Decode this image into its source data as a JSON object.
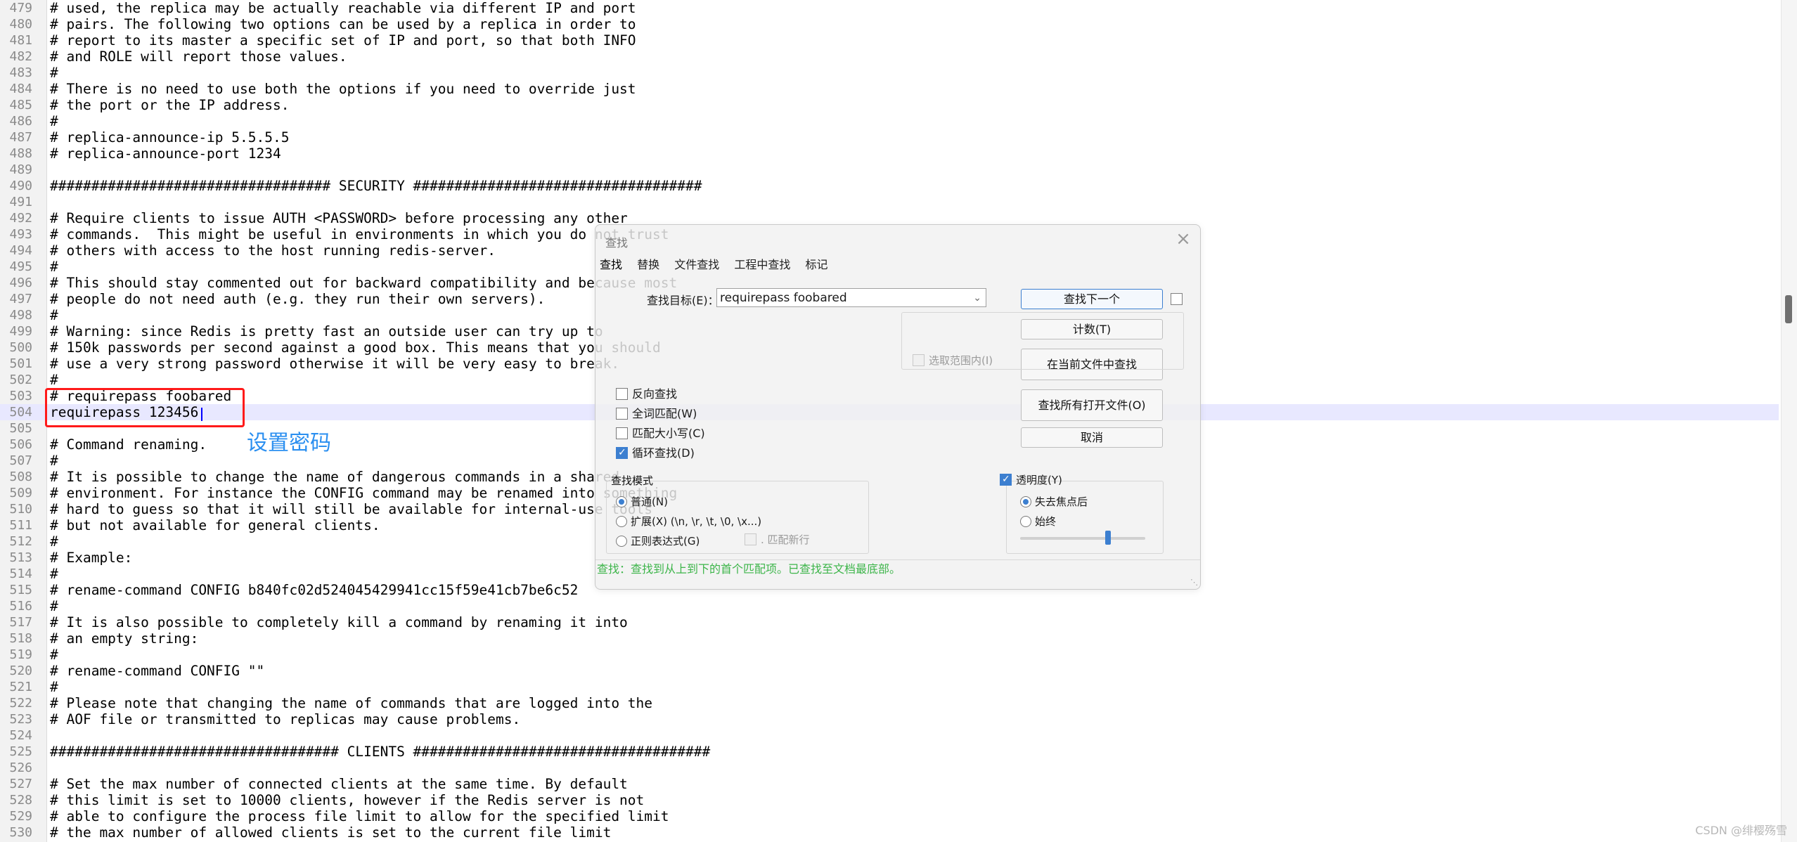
{
  "editor": {
    "lines": [
      {
        "num": "479",
        "text": "# used, the replica may be actually reachable via different IP and port"
      },
      {
        "num": "480",
        "text": "# pairs. The following two options can be used by a replica in order to"
      },
      {
        "num": "481",
        "text": "# report to its master a specific set of IP and port, so that both INFO"
      },
      {
        "num": "482",
        "text": "# and ROLE will report those values."
      },
      {
        "num": "483",
        "text": "#"
      },
      {
        "num": "484",
        "text": "# There is no need to use both the options if you need to override just"
      },
      {
        "num": "485",
        "text": "# the port or the IP address."
      },
      {
        "num": "486",
        "text": "#"
      },
      {
        "num": "487",
        "text": "# replica-announce-ip 5.5.5.5"
      },
      {
        "num": "488",
        "text": "# replica-announce-port 1234"
      },
      {
        "num": "489",
        "text": ""
      },
      {
        "num": "490",
        "text": "################################## SECURITY ###################################"
      },
      {
        "num": "491",
        "text": ""
      },
      {
        "num": "492",
        "text": "# Require clients to issue AUTH <PASSWORD> before processing any other"
      },
      {
        "num": "493",
        "text": "# commands.  This might be useful in environments in which you do not trust"
      },
      {
        "num": "494",
        "text": "# others with access to the host running redis-server."
      },
      {
        "num": "495",
        "text": "#"
      },
      {
        "num": "496",
        "text": "# This should stay commented out for backward compatibility and because most"
      },
      {
        "num": "497",
        "text": "# people do not need auth (e.g. they run their own servers)."
      },
      {
        "num": "498",
        "text": "#"
      },
      {
        "num": "499",
        "text": "# Warning: since Redis is pretty fast an outside user can try up to"
      },
      {
        "num": "500",
        "text": "# 150k passwords per second against a good box. This means that you should"
      },
      {
        "num": "501",
        "text": "# use a very strong password otherwise it will be very easy to break."
      },
      {
        "num": "502",
        "text": "#"
      },
      {
        "num": "503",
        "text": "# requirepass foobared"
      },
      {
        "num": "504",
        "text": "requirepass 123456",
        "current": true
      },
      {
        "num": "505",
        "text": ""
      },
      {
        "num": "506",
        "text": "# Command renaming."
      },
      {
        "num": "507",
        "text": "#"
      },
      {
        "num": "508",
        "text": "# It is possible to change the name of dangerous commands in a shared"
      },
      {
        "num": "509",
        "text": "# environment. For instance the CONFIG command may be renamed into something"
      },
      {
        "num": "510",
        "text": "# hard to guess so that it will still be available for internal-use tools"
      },
      {
        "num": "511",
        "text": "# but not available for general clients."
      },
      {
        "num": "512",
        "text": "#"
      },
      {
        "num": "513",
        "text": "# Example:"
      },
      {
        "num": "514",
        "text": "#"
      },
      {
        "num": "515",
        "text": "# rename-command CONFIG b840fc02d524045429941cc15f59e41cb7be6c52"
      },
      {
        "num": "516",
        "text": "#"
      },
      {
        "num": "517",
        "text": "# It is also possible to completely kill a command by renaming it into"
      },
      {
        "num": "518",
        "text": "# an empty string:"
      },
      {
        "num": "519",
        "text": "#"
      },
      {
        "num": "520",
        "text": "# rename-command CONFIG \"\""
      },
      {
        "num": "521",
        "text": "#"
      },
      {
        "num": "522",
        "text": "# Please note that changing the name of commands that are logged into the"
      },
      {
        "num": "523",
        "text": "# AOF file or transmitted to replicas may cause problems."
      },
      {
        "num": "524",
        "text": ""
      },
      {
        "num": "525",
        "text": "################################### CLIENTS ####################################"
      },
      {
        "num": "526",
        "text": ""
      },
      {
        "num": "527",
        "text": "# Set the max number of connected clients at the same time. By default"
      },
      {
        "num": "528",
        "text": "# this limit is set to 10000 clients, however if the Redis server is not"
      },
      {
        "num": "529",
        "text": "# able to configure the process file limit to allow for the specified limit"
      },
      {
        "num": "530",
        "text": "# the max number of allowed clients is set to the current file limit"
      }
    ]
  },
  "annotation": {
    "label": "设置密码",
    "highlight_color": "#ff1a1a",
    "label_color": "#2b8ff0"
  },
  "dialog": {
    "title": "查找",
    "close_icon": "close-icon",
    "tabs": [
      "查找",
      "替换",
      "文件查找",
      "工程中查找",
      "标记"
    ],
    "target_label": "查找目标(E)：",
    "target_value": "requirepass foobared",
    "buttons": {
      "find_next": "查找下一个",
      "count": "计数(T)",
      "find_in_current": "在当前文件中查找",
      "find_in_all_open": "查找所有打开文件(O)",
      "cancel": "取消"
    },
    "selection_range": "选取范围内(I)",
    "options": [
      {
        "label": "反向查找",
        "checked": false
      },
      {
        "label": "全词匹配(W)",
        "checked": false
      },
      {
        "label": "匹配大小写(C)",
        "checked": false
      },
      {
        "label": "循环查找(D)",
        "checked": true
      }
    ],
    "search_mode": {
      "title": "查找模式",
      "normal": "普通(N)",
      "extended": "扩展(X) (\\n, \\r, \\t, \\0, \\x...)",
      "regex": "正则表达式(G)",
      "dot_newline": ". 匹配新行",
      "selected": "normal"
    },
    "transparency": {
      "title": "透明度(Y)",
      "enabled": true,
      "on_lose_focus": "失去焦点后",
      "always": "始终",
      "selected": "on_lose_focus",
      "level": 0.7
    },
    "status": "查找：查找到从上到下的首个匹配项。已查找至文档最底部。",
    "status_color": "#3db54a"
  },
  "watermark": "CSDN @绯樱殇雪"
}
